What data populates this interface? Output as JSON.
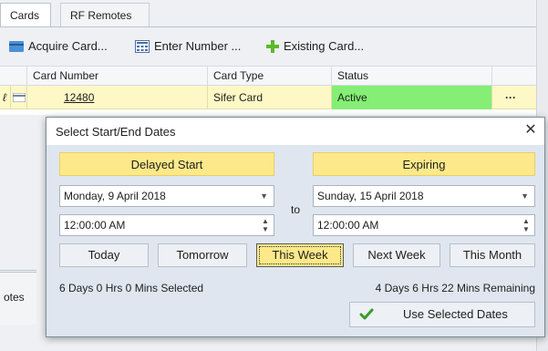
{
  "tabs": [
    {
      "label": "Cards"
    },
    {
      "label": "RF Remotes"
    }
  ],
  "toolbar": {
    "acquire_label": "Acquire Card...",
    "enter_label": "Enter Number ...",
    "existing_label": "Existing Card..."
  },
  "grid": {
    "columns": [
      "Card Number",
      "Card Type",
      "Status"
    ],
    "row": {
      "card_number": "12480",
      "card_type": "Sifer Card",
      "status": "Active",
      "more": "···"
    }
  },
  "lower_panel": {
    "tab_label": "otes"
  },
  "dialog": {
    "title": "Select Start/End Dates",
    "close_glyph": "✕",
    "start": {
      "header": "Delayed Start",
      "date": "Monday, 9 April 2018",
      "time": "12:00:00 AM"
    },
    "to_label": "to",
    "end": {
      "header": "Expiring",
      "date": "Sunday, 15 April 2018",
      "time": "12:00:00 AM"
    },
    "quick_buttons": [
      "Today",
      "Tomorrow",
      "This Week",
      "Next Week",
      "This Month"
    ],
    "selected_quick": "This Week",
    "selected_text": "6 Days 0 Hrs 0 Mins Selected",
    "remaining_text": "4 Days 6 Hrs 22 Mins Remaining",
    "use_button_label": "Use Selected Dates"
  },
  "colors": {
    "active_status": "#84ef74",
    "row_highlight": "#fdf8c6",
    "section_header": "#fde98a",
    "dialog_body": "#dfe6ef"
  }
}
